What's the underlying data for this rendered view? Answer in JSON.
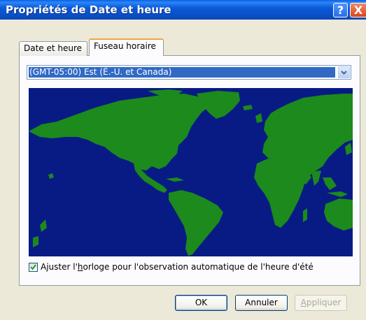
{
  "window": {
    "title": "Propriétés de Date et heure"
  },
  "titlebar": {
    "help_label": "?",
    "close_label": "X"
  },
  "tabs": [
    {
      "label": "Date et heure",
      "selected": false
    },
    {
      "label": "Fuseau horaire",
      "selected": true
    }
  ],
  "timezone": {
    "selected_value": "(GMT-05:00) Est (É.-U. et Canada)"
  },
  "dst_option": {
    "checked": true,
    "label_before": "Ajuster l'",
    "label_mnemonic": "h",
    "label_after": "orloge pour l'observation automatique de l'heure d'été"
  },
  "buttons": {
    "ok": "OK",
    "cancel": "Annuler",
    "apply_mnemonic": "A",
    "apply_rest": "ppliquer",
    "apply_enabled": false
  },
  "colors": {
    "map_ocean": "#081a84",
    "map_land": "#1c8a1c",
    "selection": "#316ac5"
  },
  "icons": [
    "help-icon",
    "close-icon",
    "chevron-down-icon",
    "checkmark-icon"
  ]
}
